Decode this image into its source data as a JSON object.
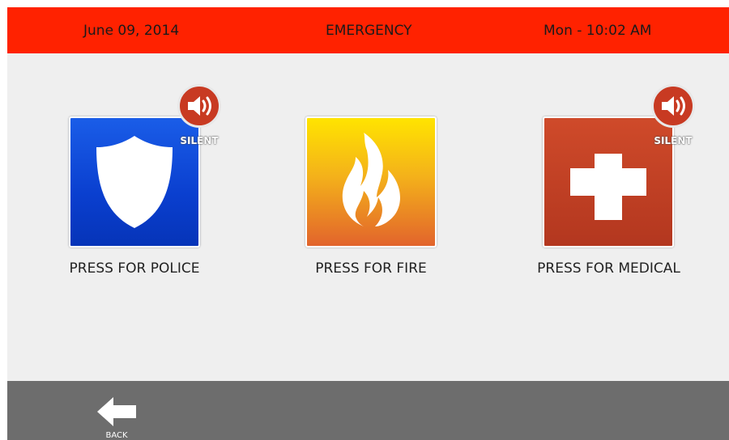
{
  "header": {
    "date": "June 09, 2014",
    "title": "EMERGENCY",
    "time": "Mon - 10:02 AM",
    "color": "#ff2200"
  },
  "panels": [
    {
      "id": "police",
      "label": "PRESS FOR POLICE",
      "icon": "shield-icon",
      "color": "#0a3fcf",
      "silent": "SILENT"
    },
    {
      "id": "fire",
      "label": "PRESS FOR FIRE",
      "icon": "flame-icon",
      "color": "#f4b21a"
    },
    {
      "id": "medical",
      "label": "PRESS FOR MEDICAL",
      "icon": "medical-cross-icon",
      "color": "#c0402a",
      "silent": "SILENT"
    }
  ],
  "silent_icon": "speaker-icon",
  "footer": {
    "back_label": "BACK",
    "back_icon": "back-arrow-icon",
    "color": "#6d6d6d"
  }
}
